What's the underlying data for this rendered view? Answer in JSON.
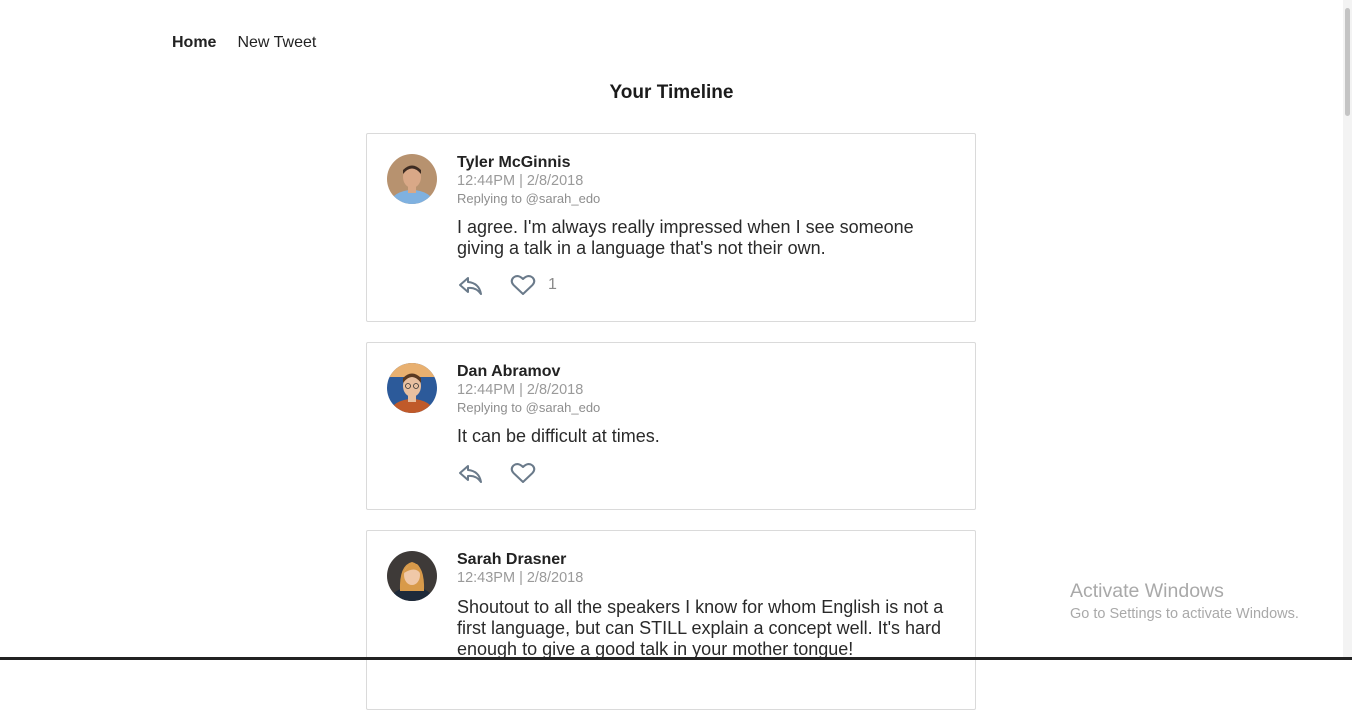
{
  "nav": {
    "home": "Home",
    "new_tweet": "New Tweet"
  },
  "page_title": "Your Timeline",
  "tweets": [
    {
      "author": "Tyler McGinnis",
      "timestamp": "12:44PM | 2/8/2018",
      "replying_to": "Replying to @sarah_edo",
      "text": "I agree. I'm always really impressed when I see someone giving a talk in a language that's not their own.",
      "likes": "1",
      "avatar_colors": {
        "bg": "#b7926f",
        "shirt": "#7fb1e0",
        "skin": "#d9a887",
        "hair": "#3d2c22"
      }
    },
    {
      "author": "Dan Abramov",
      "timestamp": "12:44PM | 2/8/2018",
      "replying_to": "Replying to @sarah_edo",
      "text": "It can be difficult at times.",
      "likes": "",
      "avatar_colors": {
        "bg": "#2c5a9a",
        "shirt": "#c05a2a",
        "skin": "#e8c0a0",
        "hair": "#5a3a22"
      }
    },
    {
      "author": "Sarah Drasner",
      "timestamp": "12:43PM | 2/8/2018",
      "replying_to": "",
      "text": "Shoutout to all the speakers I know for whom English is not a first language, but can STILL explain a concept well. It's hard enough to give a good talk in your mother tongue!",
      "likes": "",
      "avatar_colors": {
        "bg": "#3e3a38",
        "shirt": "#1e2a3a",
        "skin": "#f0c8a8",
        "hair": "#d89a4a"
      }
    }
  ],
  "icons": {
    "reply": "reply-icon",
    "like": "heart-icon"
  },
  "watermark": {
    "line1": "Activate Windows",
    "line2": "Go to Settings to activate Windows."
  }
}
